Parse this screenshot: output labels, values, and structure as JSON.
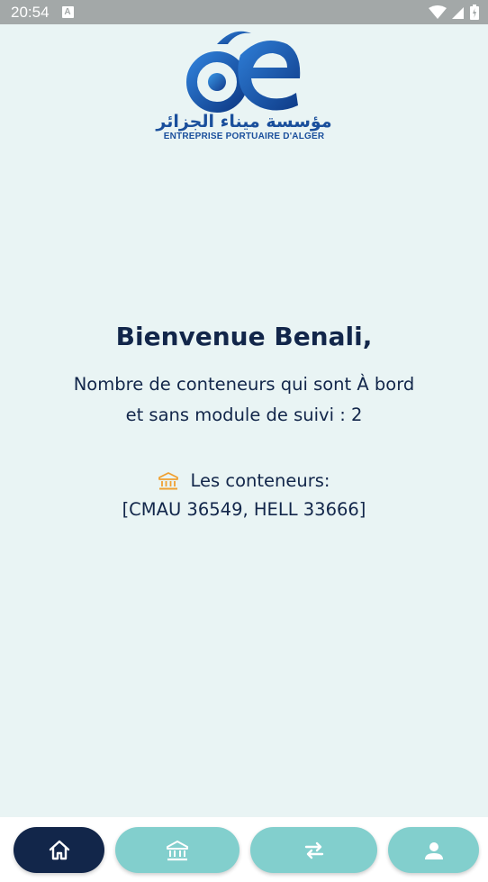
{
  "status_bar": {
    "time": "20:54",
    "app_icon_letter": "A"
  },
  "logo": {
    "arabic_text": "مؤسسة ميناء الجزائر",
    "latin_text": "ENTREPRISE PORTUAIRE D'ALGER",
    "colors": {
      "primary": "#1a4f9c"
    }
  },
  "main": {
    "welcome": "Bienvenue Benali,",
    "count_line1": "Nombre de conteneurs qui sont À bord",
    "count_line2": "et sans module de suivi : 2",
    "containers_title": "Les conteneurs:",
    "containers_list": "[CMAU 36549, HELL 33666]",
    "icon": "bank-icon"
  },
  "bottom_nav": {
    "items": [
      {
        "icon": "home-icon",
        "active": true
      },
      {
        "icon": "bank-icon",
        "active": false
      },
      {
        "icon": "transfer-arrows-icon",
        "active": false
      },
      {
        "icon": "person-icon",
        "active": false
      }
    ]
  },
  "colors": {
    "background": "#e9f4f4",
    "navy": "#12264a",
    "teal": "#82cfcd",
    "accent_orange": "#f0a030"
  }
}
